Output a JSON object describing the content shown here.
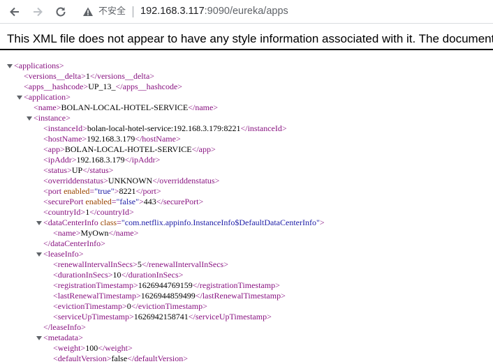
{
  "browser": {
    "security_label": "不安全",
    "url_host": "192.168.3.117",
    "url_path": ":9090/eureka/apps"
  },
  "xml_notice": "This XML file does not appear to have any style information associated with it. The document tree is shown below.",
  "xml": {
    "applications_open": "<applications>",
    "versions_delta_open": "<versions__delta>",
    "versions_delta_value": "1",
    "versions_delta_close": "</versions__delta>",
    "apps_hashcode_open": "<apps__hashcode>",
    "apps_hashcode_value": "UP_13_",
    "apps_hashcode_close": "</apps__hashcode>",
    "application_open": "<application>",
    "name_open": "<name>",
    "name_value": "BOLAN-LOCAL-HOTEL-SERVICE",
    "name_close": "</name>",
    "instance_open": "<instance>",
    "instanceId_open": "<instanceId>",
    "instanceId_value": "bolan-local-hotel-service:192.168.3.179:8221",
    "instanceId_close": "</instanceId>",
    "hostName_open": "<hostName>",
    "hostName_value": "192.168.3.179",
    "hostName_close": "</hostName>",
    "app_open": "<app>",
    "app_value": "BOLAN-LOCAL-HOTEL-SERVICE",
    "app_close": "</app>",
    "ipAddr_open": "<ipAddr>",
    "ipAddr_value": "192.168.3.179",
    "ipAddr_close": "</ipAddr>",
    "status_open": "<status>",
    "status_value": "UP",
    "status_close": "</status>",
    "overriddenstatus_open": "<overriddenstatus>",
    "overriddenstatus_value": "UNKNOWN",
    "overriddenstatus_close": "</overriddenstatus>",
    "port_open_tag": "<port",
    "port_attr_name": "enabled",
    "port_attr_value": "\"true\"",
    "port_gt": ">",
    "port_value": "8221",
    "port_close": "</port>",
    "securePort_open_tag": "<securePort",
    "securePort_attr_name": "enabled",
    "securePort_attr_value": "\"false\"",
    "securePort_gt": ">",
    "securePort_value": "443",
    "securePort_close": "</securePort>",
    "countryId_open": "<countryId>",
    "countryId_value": "1",
    "countryId_close": "</countryId>",
    "dataCenterInfo_open_tag": "<dataCenterInfo",
    "dataCenterInfo_attr_name": "class",
    "dataCenterInfo_attr_value": "\"com.netflix.appinfo.InstanceInfo$DefaultDataCenterInfo\"",
    "dataCenterInfo_gt": ">",
    "dc_name_open": "<name>",
    "dc_name_value": "MyOwn",
    "dc_name_close": "</name>",
    "dataCenterInfo_close": "</dataCenterInfo>",
    "leaseInfo_open": "<leaseInfo>",
    "renewalIntervalInSecs_open": "<renewalIntervalInSecs>",
    "renewalIntervalInSecs_value": "5",
    "renewalIntervalInSecs_close": "</renewalIntervalInSecs>",
    "durationInSecs_open": "<durationInSecs>",
    "durationInSecs_value": "10",
    "durationInSecs_close": "</durationInSecs>",
    "registrationTimestamp_open": "<registrationTimestamp>",
    "registrationTimestamp_value": "1626944769159",
    "registrationTimestamp_close": "</registrationTimestamp>",
    "lastRenewalTimestamp_open": "<lastRenewalTimestamp>",
    "lastRenewalTimestamp_value": "1626944859499",
    "lastRenewalTimestamp_close": "</lastRenewalTimestamp>",
    "evictionTimestamp_open": "<evictionTimestamp>",
    "evictionTimestamp_value": "0",
    "evictionTimestamp_close": "</evictionTimestamp>",
    "serviceUpTimestamp_open": "<serviceUpTimestamp>",
    "serviceUpTimestamp_value": "1626942158741",
    "serviceUpTimestamp_close": "</serviceUpTimestamp>",
    "leaseInfo_close": "</leaseInfo>",
    "metadata_open": "<metadata>",
    "weight_open": "<weight>",
    "weight_value": "100",
    "weight_close": "</weight>",
    "defaultVersion_open": "<defaultVersion>",
    "defaultVersion_value": "false",
    "defaultVersion_close": "</defaultVersion>"
  }
}
